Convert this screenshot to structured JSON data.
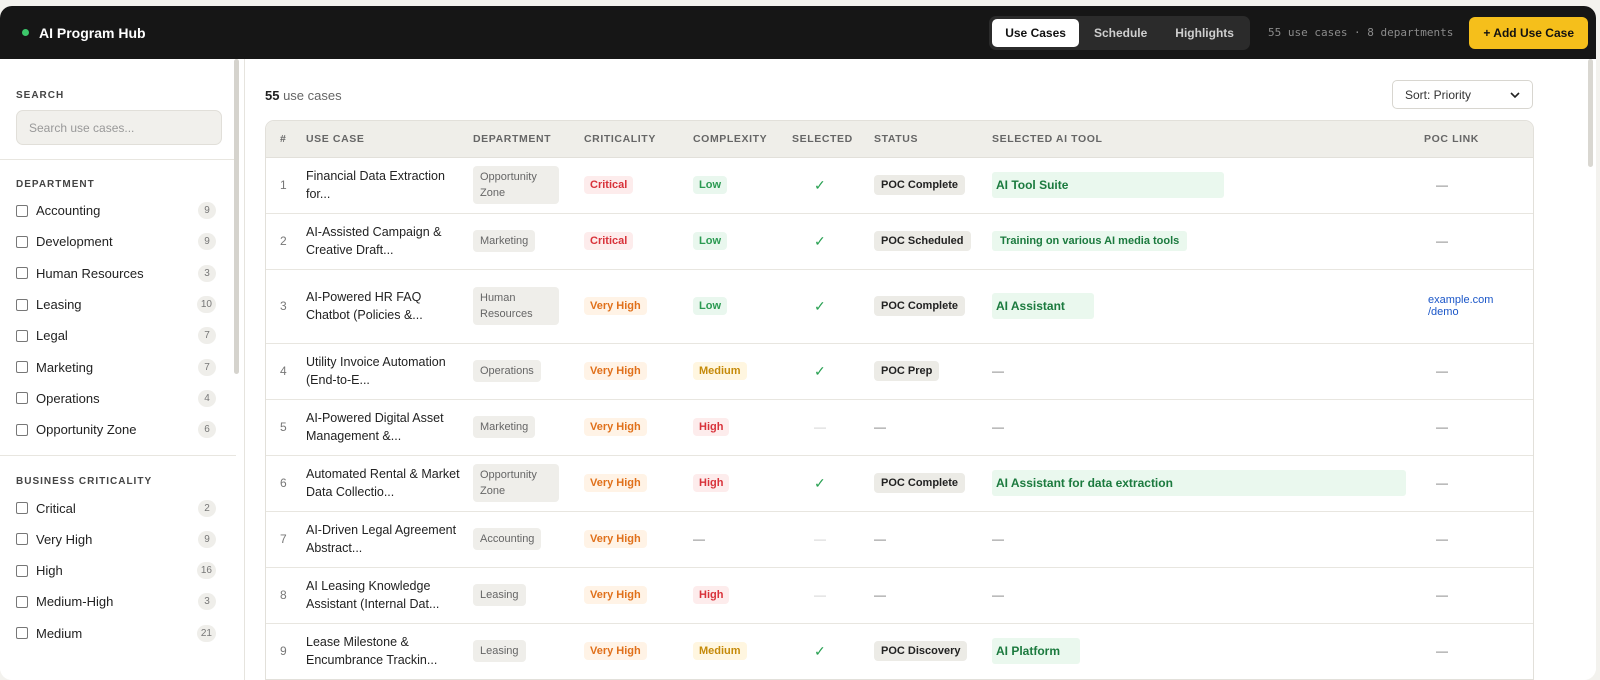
{
  "app": {
    "title": "AI Program Hub",
    "status_color": "#3cc76a"
  },
  "tabs": [
    {
      "label": "Use Cases",
      "active": true
    },
    {
      "label": "Schedule",
      "active": false
    },
    {
      "label": "Highlights",
      "active": false
    }
  ],
  "header_counts": "55 use cases · 8 departments",
  "add_button": "+ Add Use Case",
  "sidebar": {
    "search_label": "SEARCH",
    "search_placeholder": "Search use cases...",
    "department_label": "DEPARTMENT",
    "departments": [
      {
        "label": "Accounting",
        "count": "9"
      },
      {
        "label": "Development",
        "count": "9"
      },
      {
        "label": "Human Resources",
        "count": "3"
      },
      {
        "label": "Leasing",
        "count": "10"
      },
      {
        "label": "Legal",
        "count": "7"
      },
      {
        "label": "Marketing",
        "count": "7"
      },
      {
        "label": "Operations",
        "count": "4"
      },
      {
        "label": "Opportunity Zone",
        "count": "6"
      }
    ],
    "criticality_label": "BUSINESS CRITICALITY",
    "criticalities": [
      {
        "label": "Critical",
        "count": "2"
      },
      {
        "label": "Very High",
        "count": "9"
      },
      {
        "label": "High",
        "count": "16"
      },
      {
        "label": "Medium-High",
        "count": "3"
      },
      {
        "label": "Medium",
        "count": "21"
      }
    ]
  },
  "main": {
    "count_number": "55",
    "count_label": " use cases",
    "sort_label": "Sort: Priority",
    "columns": [
      "#",
      "USE CASE",
      "DEPARTMENT",
      "CRITICALITY",
      "COMPLEXITY",
      "SELECTED",
      "STATUS",
      "SELECTED AI TOOL",
      "POC LINK"
    ],
    "rows": [
      {
        "num": "1",
        "use_case": "Financial Data Extraction for...",
        "dept": "Opportunity Zone",
        "crit": "Critical",
        "complexity": "Low",
        "selected": "✓",
        "status": "POC Complete",
        "tool": "AI Tool Suite",
        "poc": "—"
      },
      {
        "num": "2",
        "use_case": "AI-Assisted Campaign & Creative Draft...",
        "dept": "Marketing",
        "crit": "Critical",
        "complexity": "Low",
        "selected": "✓",
        "status": "POC Scheduled",
        "tool": "Training on various AI media tools",
        "poc": "—"
      },
      {
        "num": "3",
        "use_case": "AI-Powered HR FAQ Chatbot (Policies &...",
        "dept": "Human Resources",
        "crit": "Very High",
        "complexity": "Low",
        "selected": "✓",
        "status": "POC Complete",
        "tool": "AI Assistant",
        "poc": "example.com /demo"
      },
      {
        "num": "4",
        "use_case": "Utility Invoice Automation (End-to-E...",
        "dept": "Operations",
        "crit": "Very High",
        "complexity": "Medium",
        "selected": "✓",
        "status": "POC Prep",
        "tool": "—",
        "poc": "—"
      },
      {
        "num": "5",
        "use_case": "AI-Powered Digital Asset Management &...",
        "dept": "Marketing",
        "crit": "Very High",
        "complexity": "High",
        "selected": "—",
        "status": "—",
        "tool": "—",
        "poc": "—"
      },
      {
        "num": "6",
        "use_case": "Automated Rental & Market Data Collectio...",
        "dept": "Opportunity Zone",
        "crit": "Very High",
        "complexity": "High",
        "selected": "✓",
        "status": "POC Complete",
        "tool": "AI Assistant for data extraction",
        "poc": "—"
      },
      {
        "num": "7",
        "use_case": "AI-Driven Legal Agreement Abstract...",
        "dept": "Accounting",
        "crit": "Very High",
        "complexity": "—",
        "selected": "—",
        "status": "—",
        "tool": "—",
        "poc": "—"
      },
      {
        "num": "8",
        "use_case": "AI Leasing Knowledge Assistant (Internal Dat...",
        "dept": "Leasing",
        "crit": "Very High",
        "complexity": "High",
        "selected": "—",
        "status": "—",
        "tool": "—",
        "poc": "—"
      },
      {
        "num": "9",
        "use_case": "Lease Milestone & Encumbrance Trackin...",
        "dept": "Leasing",
        "crit": "Very High",
        "complexity": "Medium",
        "selected": "✓",
        "status": "POC Discovery",
        "tool": "AI Platform",
        "poc": "—"
      }
    ]
  }
}
